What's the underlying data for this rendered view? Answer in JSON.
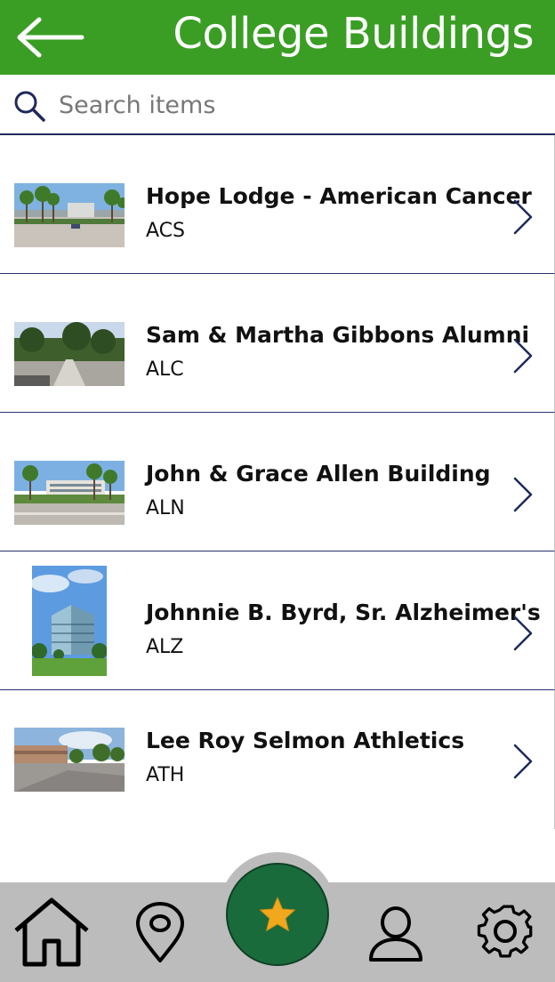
{
  "header": {
    "title": "College Buildings",
    "back_icon": "arrow-left-icon"
  },
  "search": {
    "placeholder": "Search items",
    "value": "",
    "icon": "search-icon"
  },
  "buildings": [
    {
      "name": "Hope Lodge - American Cancer",
      "code": "ACS"
    },
    {
      "name": "Sam & Martha Gibbons Alumni",
      "code": "ALC"
    },
    {
      "name": "John & Grace Allen Building",
      "code": "ALN"
    },
    {
      "name": "Johnnie B. Byrd, Sr. Alzheimer's",
      "code": "ALZ"
    },
    {
      "name": "Lee Roy Selmon Athletics",
      "code": "ATH"
    }
  ],
  "bottom_nav": {
    "items": [
      "home-icon",
      "location-pin-icon",
      "star-icon",
      "user-icon",
      "gear-icon"
    ]
  },
  "colors": {
    "header": "#3a9e24",
    "accent_navy": "#1f2a5c",
    "fav_button": "#1a6b3c",
    "star": "#f2a81d",
    "nav_bar": "#bcbcbc"
  }
}
